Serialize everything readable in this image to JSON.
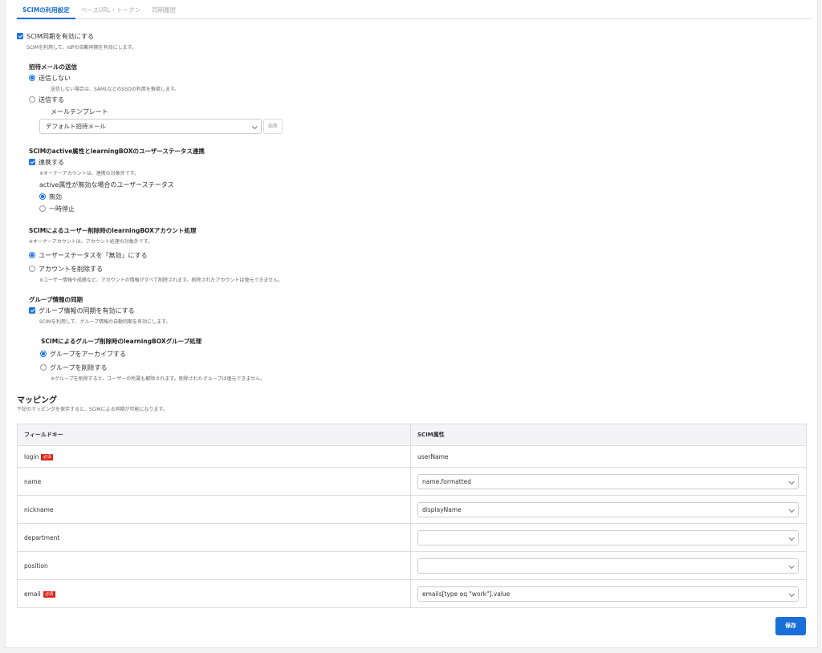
{
  "tabs": [
    {
      "label": "SCIMの利用設定",
      "active": true
    },
    {
      "label": "ベースURL・トークン",
      "active": false
    },
    {
      "label": "同期履歴",
      "active": false
    }
  ],
  "scim_enable": {
    "label": "SCIM同期を有効にする",
    "note": "SCIMを利用して、IdPの自動同期を有効にします。",
    "checked": true
  },
  "invite": {
    "title": "招待メールの送信",
    "no_send": {
      "label": "送信しない",
      "note": "送信しない場合は、SAMLなどのSSOの利用を推奨します。",
      "selected": true
    },
    "send": {
      "label": "送信する",
      "selected": false
    },
    "template_label": "メールテンプレート",
    "template_value": "デフォルト招待メール",
    "edit_label": "編集"
  },
  "active_sync": {
    "title": "SCIMのactive属性とlearningBOXのユーザーステータス連携",
    "checkbox_label": "連携する",
    "checkbox_note": "※オーナーアカウントは、連携の対象外です。",
    "subtitle": "active属性が無効な場合のユーザーステータス",
    "opt_disabled": "無効",
    "opt_suspend": "一時停止"
  },
  "user_delete": {
    "title": "SCIMによるユーザー削除時のlearningBOXアカウント処理",
    "note": "※オーナーアカウントは、アカウント処理の対象外です。",
    "opt_disable": "ユーザーステータスを「無効」にする",
    "opt_delete": "アカウントを削除する",
    "opt_delete_note": "※ユーザー情報や成績など、アカウントの情報がすべて削除されます。削除されたアカウントは復元できません。"
  },
  "group_sync": {
    "title": "グループ情報の同期",
    "checkbox_label": "グループ情報の同期を有効にする",
    "checkbox_note": "SCIMを利用して、グループ情報の自動同期を有効にします。",
    "delete_title": "SCIMによるグループ削除時のlearningBOXグループ処理",
    "opt_archive": "グループをアーカイブする",
    "opt_delete": "グループを削除する",
    "opt_delete_note": "※グループを削除すると、ユーザーの所属も解除されます。削除されたグループは復元できません。"
  },
  "mapping": {
    "title": "マッピング",
    "note": "下記のマッピングを保存すると、SCIMによる同期が可能になります。",
    "col_field": "フィールドキー",
    "col_attr": "SCIM属性",
    "required_label": "必須",
    "rows": [
      {
        "key": "login",
        "value": "userName"
      },
      {
        "key": "name",
        "value": "name.formatted"
      },
      {
        "key": "nickname",
        "value": "displayName"
      },
      {
        "key": "department",
        "value": ""
      },
      {
        "key": "position",
        "value": ""
      },
      {
        "key": "email",
        "value": "emails[type eq \"work\"].value"
      }
    ]
  },
  "save_label": "保存",
  "colors": {
    "accent": "#1a6ed8",
    "required": "#d9241a"
  }
}
